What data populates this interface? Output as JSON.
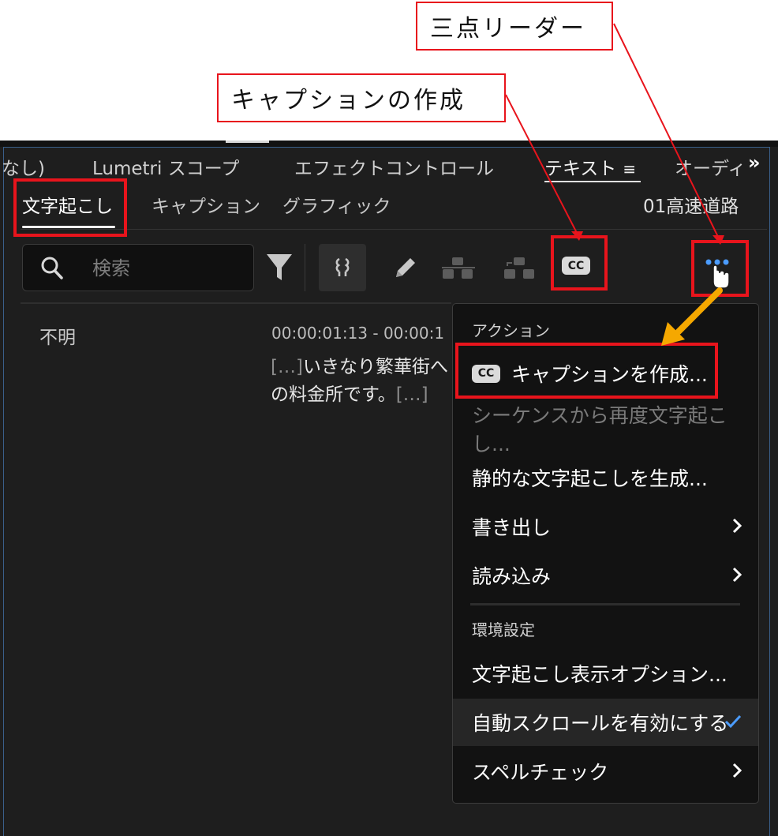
{
  "annotations": {
    "leader_label": "三点リーダー",
    "caption_label": "キャプションの作成"
  },
  "panel_tabs": [
    {
      "label": "なし)"
    },
    {
      "label": "Lumetri スコープ"
    },
    {
      "label": "エフェクトコントロール"
    },
    {
      "label": "テキスト"
    },
    {
      "label": "オーディ"
    }
  ],
  "panel_tab_menu_glyph": "≡",
  "overflow_glyph": "»",
  "sub_tabs": [
    {
      "label": "文字起こし"
    },
    {
      "label": "キャプション"
    },
    {
      "label": "グラフィック"
    }
  ],
  "sequence_name": "01高速道路",
  "search": {
    "placeholder": "検索",
    "value": ""
  },
  "transcript": {
    "speaker": "不明",
    "timecode": "00:00:01:13 - 00:00:1",
    "gap_start": "[…]",
    "line1_text": "いきなり繁華街へ",
    "line2_text": "の料金所です。",
    "gap_end": "[…]"
  },
  "menu": {
    "actions_header": "アクション",
    "create_captions": "キャプションを作成...",
    "cc_badge": "CC",
    "retranscribe": "シーケンスから再度文字起こし...",
    "static_transcript": "静的な文字起こしを生成...",
    "export": "書き出し",
    "import": "読み込み",
    "prefs_header": "環境設定",
    "display_options": "文字起こし表示オプション...",
    "autoscroll": "自動スクロールを有効にする",
    "spellcheck": "スペルチェック"
  },
  "toolbar": {
    "cc_button_label": "CC"
  },
  "colors": {
    "annotation_red": "#e8141c",
    "arrow_orange": "#f5a800",
    "accent_blue": "#4b9cff",
    "panel_bg": "#1e1e1e",
    "menu_bg": "#121212"
  }
}
